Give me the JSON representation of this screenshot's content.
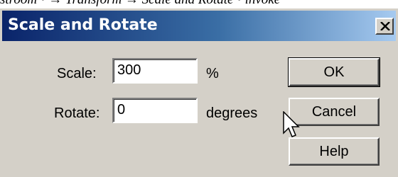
{
  "background_text": "stroom • → Transform → Scale and Rotate • invoke",
  "dialog": {
    "title": "Scale and Rotate",
    "close_glyph": "✕"
  },
  "scale": {
    "label": "Scale:",
    "value": "300",
    "unit": "%"
  },
  "rotate": {
    "label": "Rotate:",
    "value": "0",
    "unit": "degrees"
  },
  "buttons": {
    "ok": "OK",
    "cancel": "Cancel",
    "help": "Help"
  },
  "colors": {
    "titlebar_start": "#0a246a",
    "titlebar_end": "#a6caf0",
    "face": "#d4d0c8"
  }
}
